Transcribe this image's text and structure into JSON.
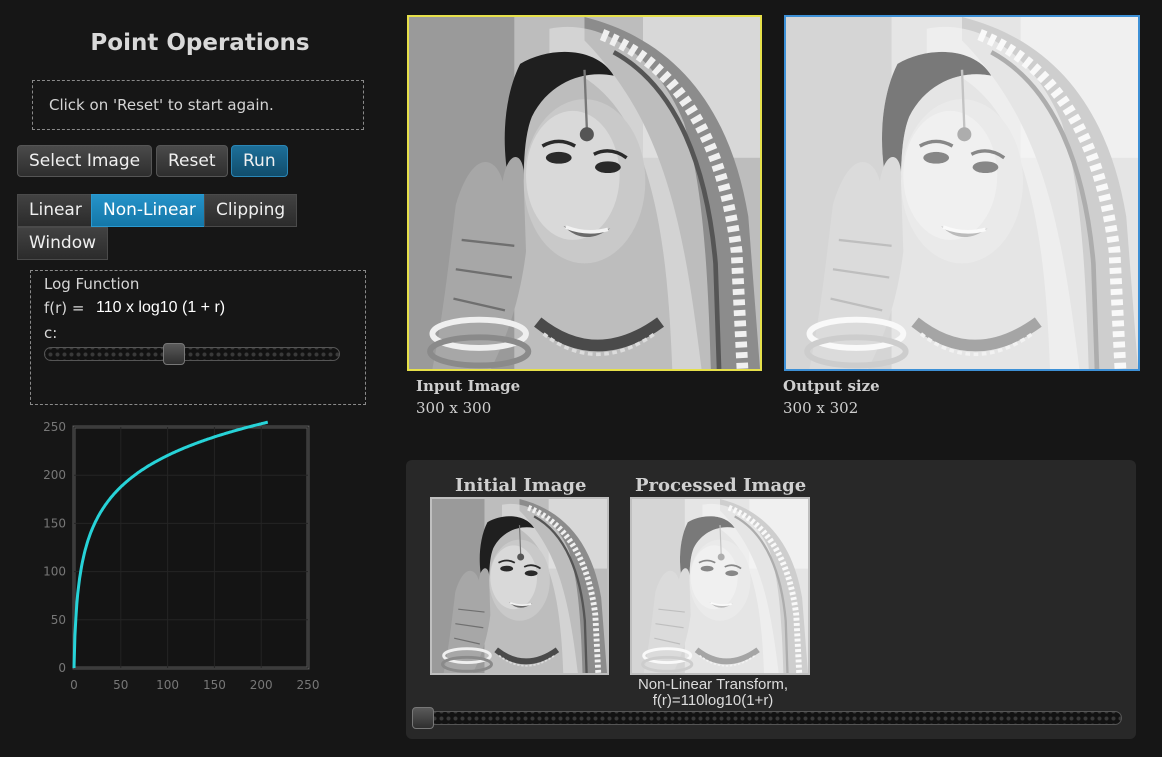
{
  "app": {
    "title": "Point Operations"
  },
  "message": "Click on 'Reset' to start again.",
  "actions": {
    "select_image": "Select Image",
    "reset": "Reset",
    "run": "Run"
  },
  "tabs": [
    {
      "label": "Linear",
      "active": false
    },
    {
      "label": "Non-Linear",
      "active": true
    },
    {
      "label": "Clipping",
      "active": false
    },
    {
      "label": "Window",
      "active": false
    }
  ],
  "log_function": {
    "title": "Log Function",
    "formula_label": "f(r) =",
    "formula_value": "110 x log10 (1 + r)",
    "c_label": "c:",
    "c_slider_fraction": 0.44
  },
  "chart_data": {
    "type": "line",
    "title": "",
    "xlabel": "",
    "ylabel": "",
    "xlim": [
      0,
      250
    ],
    "ylim": [
      0,
      250
    ],
    "x_ticks": [
      "0",
      "50",
      "100",
      "150",
      "200",
      "250"
    ],
    "y_ticks": [
      "0",
      "50",
      "100",
      "150",
      "200",
      "250"
    ],
    "grid": true,
    "series": [
      {
        "color": "#27d3d8",
        "function": "110*log10(1+r)",
        "x_range": [
          0,
          207
        ]
      }
    ]
  },
  "input_image": {
    "title": "Input Image",
    "size": "300 x 300"
  },
  "output_image": {
    "title": "Output size",
    "size": "300 x 302"
  },
  "comparison": {
    "initial_title": "Initial Image",
    "processed_title": "Processed Image",
    "caption_line1": "Non-Linear Transform,",
    "caption_line2": "f(r)=110log10(1+r)",
    "slider_fraction": 0.0
  },
  "colors": {
    "input_border": "#e6e04a",
    "output_border": "#3d90d6",
    "active_tab": "#1e86bb",
    "curve": "#27d3d8"
  }
}
